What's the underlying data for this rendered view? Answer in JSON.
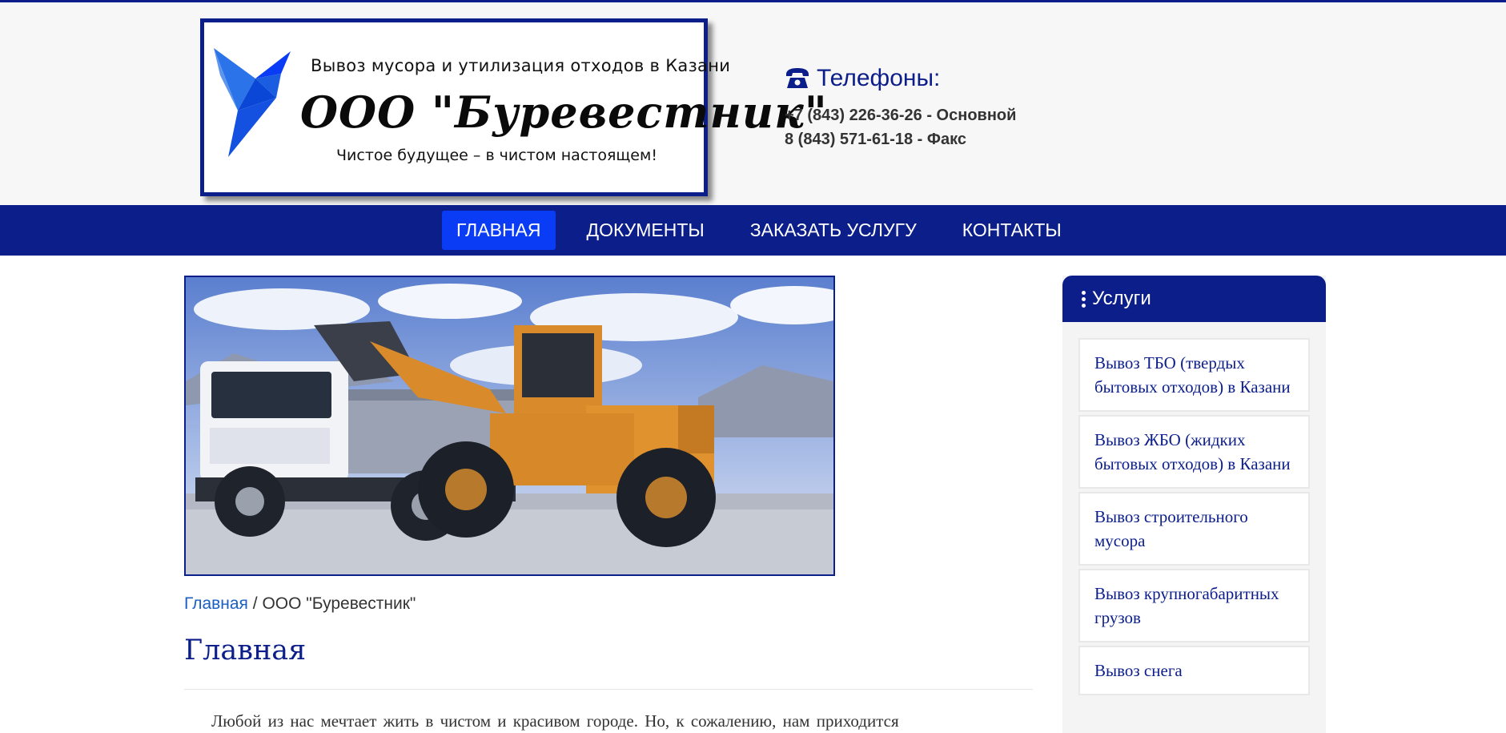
{
  "header": {
    "logo": {
      "tagline_top": "Вывоз мусора и утилизация отходов в Казани",
      "company_name": "ООО \"Буревестник\"",
      "tagline_bottom": "Чистое будущее – в чистом настоящем!"
    },
    "phones": {
      "title": "Телефоны:",
      "lines": [
        "+7 (843) 226-36-26 - Основной",
        "8 (843) 571-61-18 - Факс"
      ]
    }
  },
  "nav": {
    "items": [
      {
        "label": "Главная",
        "active": true
      },
      {
        "label": "Документы",
        "active": false
      },
      {
        "label": "Заказать услугу",
        "active": false
      },
      {
        "label": "Контакты",
        "active": false
      }
    ]
  },
  "breadcrumb": {
    "home": "Главная",
    "separator": "/",
    "current": "ООО \"Буревестник\""
  },
  "main": {
    "title": "Главная",
    "intro": "Любой из нас мечтает жить в чистом и красивом городе. Но, к сожалению, нам приходится"
  },
  "sidebar": {
    "title": "Услуги",
    "items": [
      "Вывоз ТБО (твердых бытовых отходов) в Казани",
      "Вывоз ЖБО (жидких бытовых отходов) в Казани",
      "Вывоз строительного мусора",
      "Вывоз крупногабаритных грузов",
      "Вывоз снега"
    ]
  },
  "colors": {
    "brand": "#0c1e8a",
    "active_nav": "#0a3cf5",
    "link": "#1a5fc4"
  }
}
